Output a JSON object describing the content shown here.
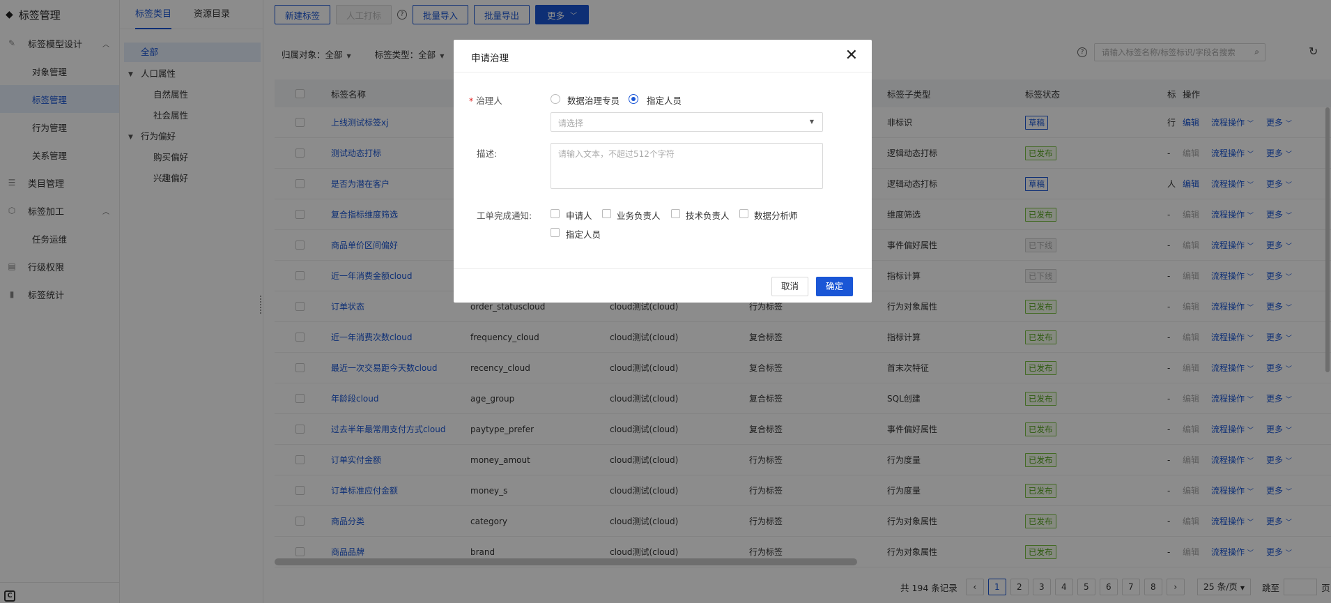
{
  "sidebar": {
    "brand": "标签管理",
    "groups": [
      {
        "label": "标签模型设计",
        "icon": "model-design-icon",
        "expanded": true,
        "children": [
          "对象管理",
          "标签管理",
          "行为管理",
          "关系管理"
        ]
      },
      {
        "label": "类目管理",
        "icon": "category-icon"
      },
      {
        "label": "标签加工",
        "icon": "tag-process-icon",
        "expanded": true,
        "children": [
          "任务运维"
        ]
      },
      {
        "label": "行级权限",
        "icon": "row-permission-icon"
      },
      {
        "label": "标签统计",
        "icon": "bar-chart-icon"
      }
    ],
    "active_child": "标签管理"
  },
  "tree": {
    "tabs": [
      "标签类目",
      "资源目录"
    ],
    "active_tab": "标签类目",
    "nodes": [
      "全部",
      "人口属性",
      "自然属性",
      "社会属性",
      "行为偏好",
      "购买偏好",
      "兴趣偏好"
    ]
  },
  "toolbar": {
    "new_tag": "新建标签",
    "manual_tag": "人工打标",
    "batch_import": "批量导入",
    "batch_export": "批量导出",
    "more": "更多"
  },
  "filters": {
    "owner_object": "归属对象：全部",
    "tag_type": "标签类型：全部"
  },
  "search": {
    "placeholder": "请输入标签名称/标签标识/字段名搜索"
  },
  "table": {
    "headers": {
      "name": "标签名称",
      "subtype": "标签子类型",
      "status": "标签状态",
      "col_trunc": "标",
      "ops": "操作"
    },
    "rows": [
      {
        "name": "上线测试标签xj",
        "field": "",
        "object": "",
        "type": "",
        "subtype": "非标识",
        "status": "草稿",
        "trunc": "行",
        "edit_enabled": true
      },
      {
        "name": "测试动态打标",
        "field": "",
        "object": "",
        "type": "",
        "subtype": "逻辑动态打标",
        "status": "已发布",
        "trunc": "-",
        "edit_enabled": false
      },
      {
        "name": "是否为潜在客户",
        "field": "",
        "object": "",
        "type": "",
        "subtype": "逻辑动态打标",
        "status": "草稿",
        "trunc": "人",
        "edit_enabled": true
      },
      {
        "name": "复合指标维度筛选",
        "field": "",
        "object": "",
        "type": "",
        "subtype": "维度筛选",
        "status": "已发布",
        "trunc": "-",
        "edit_enabled": false
      },
      {
        "name": "商品单价区间偏好",
        "field": "",
        "object": "",
        "type": "",
        "subtype": "事件偏好属性",
        "status": "已下线",
        "trunc": "-",
        "edit_enabled": false
      },
      {
        "name": "近一年消费金额cloud",
        "field": "",
        "object": "",
        "type": "",
        "subtype": "指标计算",
        "status": "已下线",
        "trunc": "-",
        "edit_enabled": false
      },
      {
        "name": "订单状态",
        "field": "order_statuscloud",
        "object": "cloud测试(cloud)",
        "type": "行为标签",
        "subtype": "行为对象属性",
        "status": "已发布",
        "trunc": "-",
        "edit_enabled": false
      },
      {
        "name": "近一年消费次数cloud",
        "field": "frequency_cloud",
        "object": "cloud测试(cloud)",
        "type": "复合标签",
        "subtype": "指标计算",
        "status": "已发布",
        "trunc": "-",
        "edit_enabled": false
      },
      {
        "name": "最近一次交易距今天数cloud",
        "field": "recency_cloud",
        "object": "cloud测试(cloud)",
        "type": "复合标签",
        "subtype": "首末次特征",
        "status": "已发布",
        "trunc": "-",
        "edit_enabled": false
      },
      {
        "name": "年龄段cloud",
        "field": "age_group",
        "object": "cloud测试(cloud)",
        "type": "复合标签",
        "subtype": "SQL创建",
        "status": "已发布",
        "trunc": "-",
        "edit_enabled": false
      },
      {
        "name": "过去半年最常用支付方式cloud",
        "field": "paytype_prefer",
        "object": "cloud测试(cloud)",
        "type": "复合标签",
        "subtype": "事件偏好属性",
        "status": "已发布",
        "trunc": "-",
        "edit_enabled": false
      },
      {
        "name": "订单实付金额",
        "field": "money_amout",
        "object": "cloud测试(cloud)",
        "type": "行为标签",
        "subtype": "行为度量",
        "status": "已发布",
        "trunc": "-",
        "edit_enabled": false
      },
      {
        "name": "订单标准应付金额",
        "field": "money_s",
        "object": "cloud测试(cloud)",
        "type": "行为标签",
        "subtype": "行为度量",
        "status": "已发布",
        "trunc": "-",
        "edit_enabled": false
      },
      {
        "name": "商品分类",
        "field": "category",
        "object": "cloud测试(cloud)",
        "type": "行为标签",
        "subtype": "行为对象属性",
        "status": "已发布",
        "trunc": "-",
        "edit_enabled": false
      },
      {
        "name": "商品品牌",
        "field": "brand",
        "object": "cloud测试(cloud)",
        "type": "行为标签",
        "subtype": "行为对象属性",
        "status": "已发布",
        "trunc": "-",
        "edit_enabled": false
      }
    ],
    "op_labels": {
      "edit": "编辑",
      "flow": "流程操作",
      "more": "更多"
    }
  },
  "status_colors": {
    "草稿": {
      "border": "#1a56d6",
      "text": "#1a56d6",
      "bg": "#ffffff"
    },
    "已发布": {
      "border": "#7ac143",
      "text": "#52a41a",
      "bg": "#f4fbec"
    },
    "已下线": {
      "border": "#d0d0d0",
      "text": "#aaaaaa",
      "bg": "#f5f5f5"
    }
  },
  "pagination": {
    "total": "共 194 条记录",
    "pages": [
      "1",
      "2",
      "3",
      "4",
      "5",
      "6",
      "7",
      "8"
    ],
    "current": "1",
    "page_size": "25 条/页",
    "jump": "跳至",
    "page_suffix": "页"
  },
  "dialog": {
    "title": "申请治理",
    "governor_label": "治理人",
    "radio_options": [
      "数据治理专员",
      "指定人员"
    ],
    "radio_selected": "指定人员",
    "select_placeholder": "请选择",
    "desc_label": "描述:",
    "desc_placeholder": "请输入文本，不超过512个字符",
    "notify_label": "工单完成通知:",
    "notify_options": [
      "申请人",
      "业务负责人",
      "技术负责人",
      "数据分析师",
      "指定人员"
    ],
    "cancel": "取消",
    "confirm": "确定"
  }
}
